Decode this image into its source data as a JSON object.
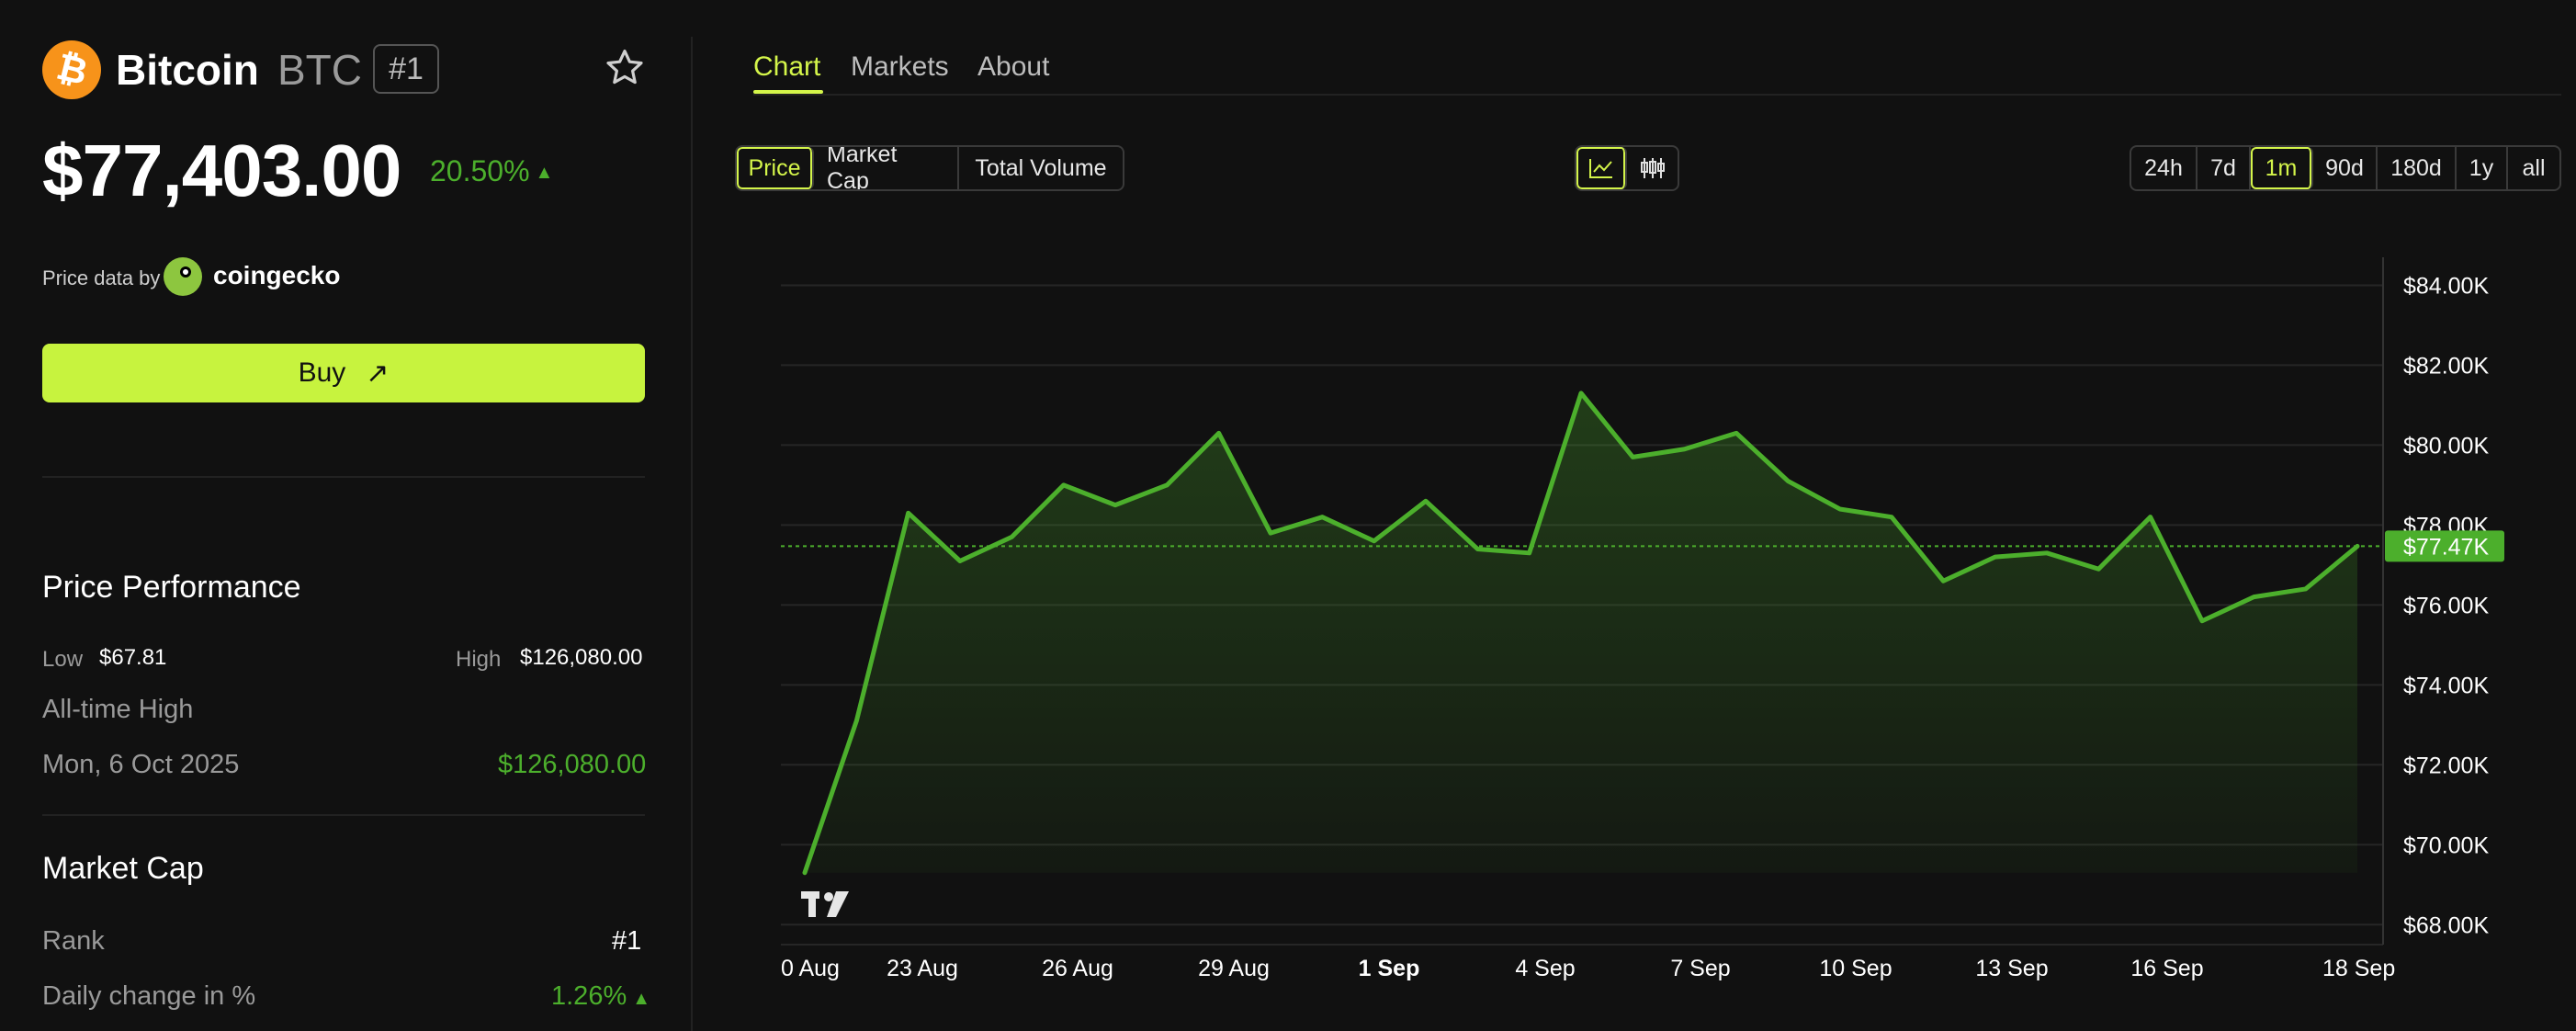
{
  "coin": {
    "icon": "bitcoin-icon",
    "name": "Bitcoin",
    "symbol": "BTC",
    "rank_badge": "#1",
    "price": "$77,403.00",
    "change": "20.50%",
    "change_arrow": "▲"
  },
  "source": {
    "label": "Price data by",
    "name": "coingecko"
  },
  "buy": {
    "label": "Buy",
    "arrow": "↗"
  },
  "performance": {
    "title": "Price Performance",
    "low_label": "Low",
    "low_value": "$67.81",
    "high_label": "High",
    "high_value": "$126,080.00",
    "ath_label": "All-time High",
    "ath_date": "Mon, 6 Oct 2025",
    "ath_value": "$126,080.00"
  },
  "market_cap": {
    "title": "Market Cap",
    "rank_label": "Rank",
    "rank_value": "#1",
    "daily_label": "Daily change in %",
    "daily_value": "1.26%",
    "daily_arrow": "▲"
  },
  "tabs": [
    {
      "label": "Chart",
      "active": true
    },
    {
      "label": "Markets",
      "active": false
    },
    {
      "label": "About",
      "active": false
    }
  ],
  "metrics": [
    "Price",
    "Market Cap",
    "Total Volume"
  ],
  "selected_metric": "Price",
  "chart_types": [
    "line-chart-icon",
    "candlestick-icon"
  ],
  "ranges": [
    "24h",
    "7d",
    "1m",
    "90d",
    "180d",
    "1y",
    "all"
  ],
  "selected_range": "1m",
  "colors": {
    "accent": "#d4f54a",
    "line": "#4caf2c",
    "buy": "#c7f33e"
  },
  "chart_data": {
    "type": "area",
    "y_tick_labels": [
      "$84.00K",
      "$82.00K",
      "$80.00K",
      "$78.00K",
      "$76.00K",
      "$74.00K",
      "$72.00K",
      "$70.00K",
      "$68.00K"
    ],
    "y_ticks": [
      84000,
      82000,
      80000,
      78000,
      76000,
      74000,
      72000,
      70000,
      68000
    ],
    "ylim": [
      67500,
      84700
    ],
    "x_tick_labels": [
      "0 Aug",
      "23 Aug",
      "26 Aug",
      "29 Aug",
      "1 Sep",
      "4 Sep",
      "7 Sep",
      "10 Sep",
      "13 Sep",
      "16 Sep",
      "18 Sep"
    ],
    "current_label": "$77.47K",
    "current_value": 77470,
    "values": [
      69300,
      73100,
      78300,
      77100,
      77700,
      79000,
      78500,
      79000,
      80300,
      77800,
      78200,
      77600,
      78600,
      77400,
      77300,
      81300,
      79700,
      79900,
      80300,
      79100,
      78400,
      78200,
      76600,
      77200,
      77300,
      76900,
      78200,
      75600,
      76200,
      76400,
      77470
    ],
    "grid": true
  }
}
